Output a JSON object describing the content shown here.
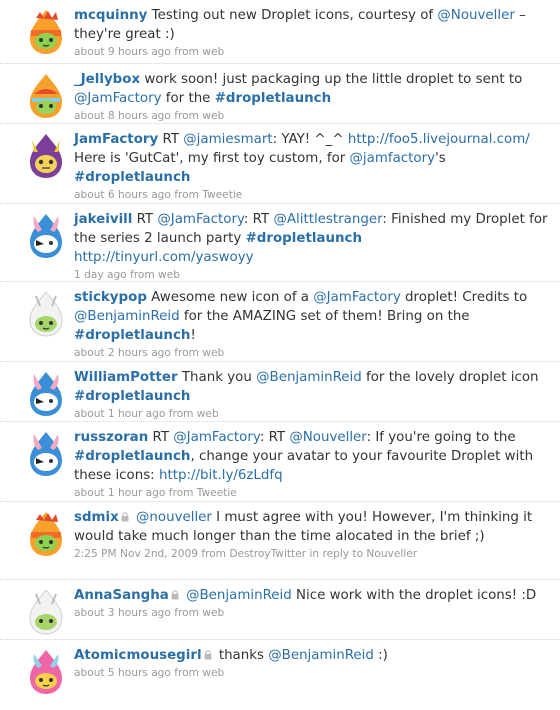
{
  "tweets": [
    {
      "user": "mcquinny",
      "t1": " Testing out new Droplet icons, courtesy of ",
      "m1": "@Nouveller",
      "t2": " – they're great :)",
      "meta": "about 9 hours ago from web"
    },
    {
      "user": "_Jellybox",
      "t1": " work soon! just packaging up the little droplet to sent to ",
      "m1": "@JamFactory",
      "t2": " for the ",
      "h1": "#dropletlaunch",
      "meta": "about 8 hours ago from web"
    },
    {
      "user": "JamFactory",
      "t1": " RT ",
      "m1": "@jamiesmart",
      "t2": ": YAY! ^_^ ",
      "u1": "http://foo5.livejournal.com/",
      "t3": " Here is 'GutCat', my first toy custom, for ",
      "m2": "@jamfactory",
      "t4": "'s ",
      "h1": "#dropletlaunch",
      "meta": "about 6 hours ago from Tweetie"
    },
    {
      "user": "jakeivill",
      "t1": " RT ",
      "m1": "@JamFactory",
      "t2": ": RT ",
      "m2": "@Alittlestranger",
      "t3": ": Finished my Droplet for the series 2 launch party ",
      "h1": "#dropletlaunch",
      "u1": "http://tinyurl.com/yaswoyy",
      "meta": "1 day ago from web"
    },
    {
      "user": "stickypop",
      "t1": " Awesome new icon of a ",
      "m1": "@JamFactory",
      "t2": " droplet! Credits to ",
      "m2": "@BenjaminReid",
      "t3": " for the AMAZING set of them! Bring on the ",
      "h1": "#dropletlaunch",
      "t4": "!",
      "meta": "about 2 hours ago from web"
    },
    {
      "user": "WilliamPotter",
      "t1": " Thank you ",
      "m1": "@BenjaminReid",
      "t2": " for the lovely droplet icon ",
      "h1": "#dropletlaunch",
      "meta": "about 1 hour ago from web"
    },
    {
      "user": "russzoran",
      "t1": " RT ",
      "m1": "@JamFactory",
      "t2": ": RT ",
      "m2": "@Nouveller",
      "t3": ": If you're going to the ",
      "h1": "#dropletlaunch",
      "t4": ", change your avatar to your favourite Droplet with these icons: ",
      "u1": "http://bit.ly/6zLdfq",
      "meta": "about 1 hour ago from Tweetie"
    },
    {
      "user": "sdmix",
      "t1": " ",
      "m1": "@nouveller",
      "t2": " I must agree with you! However, I'm thinking it would take much longer than the time alocated in the brief ;)",
      "meta": "2:25 PM Nov 2nd, 2009 from DestroyTwitter in reply to Nouveller"
    },
    {
      "user": "AnnaSangha",
      "t1": " ",
      "m1": "@BenjaminReid",
      "t2": " Nice work with the droplet icons! :D",
      "meta": "about 3 hours ago from web"
    },
    {
      "user": "Atomicmousegirl",
      "t1": " thanks ",
      "m1": "@BenjaminReid",
      "t2": " :)",
      "meta": "about 5 hours ago from web"
    }
  ]
}
